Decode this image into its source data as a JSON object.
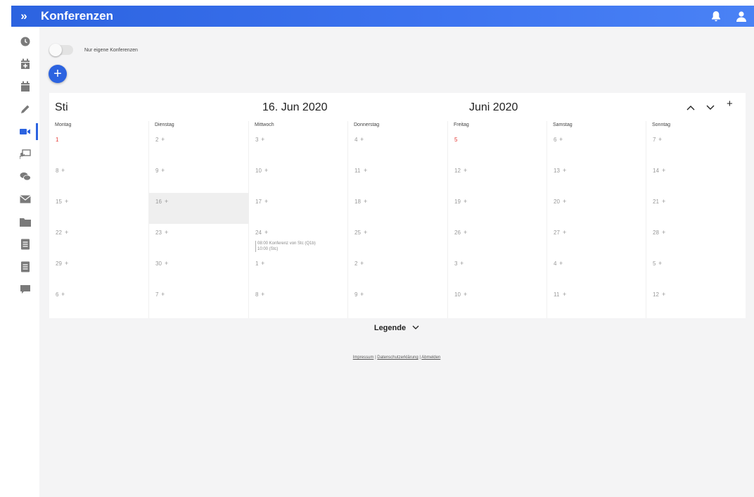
{
  "app": {
    "title": "Konferenzen",
    "expand_icon": "»"
  },
  "toolbar": {
    "notifications_icon": "bell-icon",
    "user_icon": "user-icon"
  },
  "sidebar": {
    "items": [
      {
        "icon": "clock-icon"
      },
      {
        "icon": "calendar-add-icon"
      },
      {
        "icon": "calendar-icon"
      },
      {
        "icon": "pencil-icon"
      },
      {
        "icon": "video-camera-icon",
        "active": true
      },
      {
        "icon": "presentation-icon"
      },
      {
        "icon": "chat-icon"
      },
      {
        "icon": "mail-icon"
      },
      {
        "icon": "folder-icon"
      },
      {
        "icon": "book-icon"
      },
      {
        "icon": "book-icon"
      },
      {
        "icon": "message-icon"
      }
    ]
  },
  "filter": {
    "own_conferences_label": "Nur eigene Konferenzen",
    "own_conferences_on": false
  },
  "add_button": "+",
  "calendar": {
    "view_label": "Sti",
    "selected_date": "16. Jun 2020",
    "month_label": "Juni 2020",
    "nav": {
      "prev": "^",
      "next": "v",
      "add": "+"
    },
    "weekdays": [
      "Montag",
      "Dienstag",
      "Mittwoch",
      "Donnerstag",
      "Freitag",
      "Samstag",
      "Sonntag"
    ],
    "add_symbol": "+",
    "weeks": [
      [
        {
          "day": "1",
          "holiday": true
        },
        {
          "day": "2"
        },
        {
          "day": "3"
        },
        {
          "day": "4"
        },
        {
          "day": "5",
          "holiday": true
        },
        {
          "day": "6"
        },
        {
          "day": "7"
        }
      ],
      [
        {
          "day": "8"
        },
        {
          "day": "9"
        },
        {
          "day": "10"
        },
        {
          "day": "11"
        },
        {
          "day": "12"
        },
        {
          "day": "13"
        },
        {
          "day": "14"
        }
      ],
      [
        {
          "day": "15"
        },
        {
          "day": "16",
          "today": true
        },
        {
          "day": "17"
        },
        {
          "day": "18"
        },
        {
          "day": "19"
        },
        {
          "day": "20"
        },
        {
          "day": "21"
        }
      ],
      [
        {
          "day": "22"
        },
        {
          "day": "23"
        },
        {
          "day": "24",
          "event": {
            "line1": "08:00  Konferenz von Stc (Q1b)",
            "line2": "10:00  (Stc)"
          }
        },
        {
          "day": "25"
        },
        {
          "day": "26"
        },
        {
          "day": "27"
        },
        {
          "day": "28"
        }
      ],
      [
        {
          "day": "29"
        },
        {
          "day": "30"
        },
        {
          "day": "1"
        },
        {
          "day": "2"
        },
        {
          "day": "3"
        },
        {
          "day": "4"
        },
        {
          "day": "5"
        }
      ],
      [
        {
          "day": "6"
        },
        {
          "day": "7"
        },
        {
          "day": "8"
        },
        {
          "day": "9"
        },
        {
          "day": "10"
        },
        {
          "day": "11"
        },
        {
          "day": "12"
        }
      ]
    ]
  },
  "legend": {
    "label": "Legende",
    "chevron": "⌄"
  },
  "footer": {
    "impressum": "Impressum",
    "privacy": "Datenschutzerklärung",
    "logout": "Abmelden",
    "separator": "|"
  },
  "colors": {
    "accent": "#2c63e0",
    "holiday": "#e53935",
    "today_bg": "#efefef"
  }
}
